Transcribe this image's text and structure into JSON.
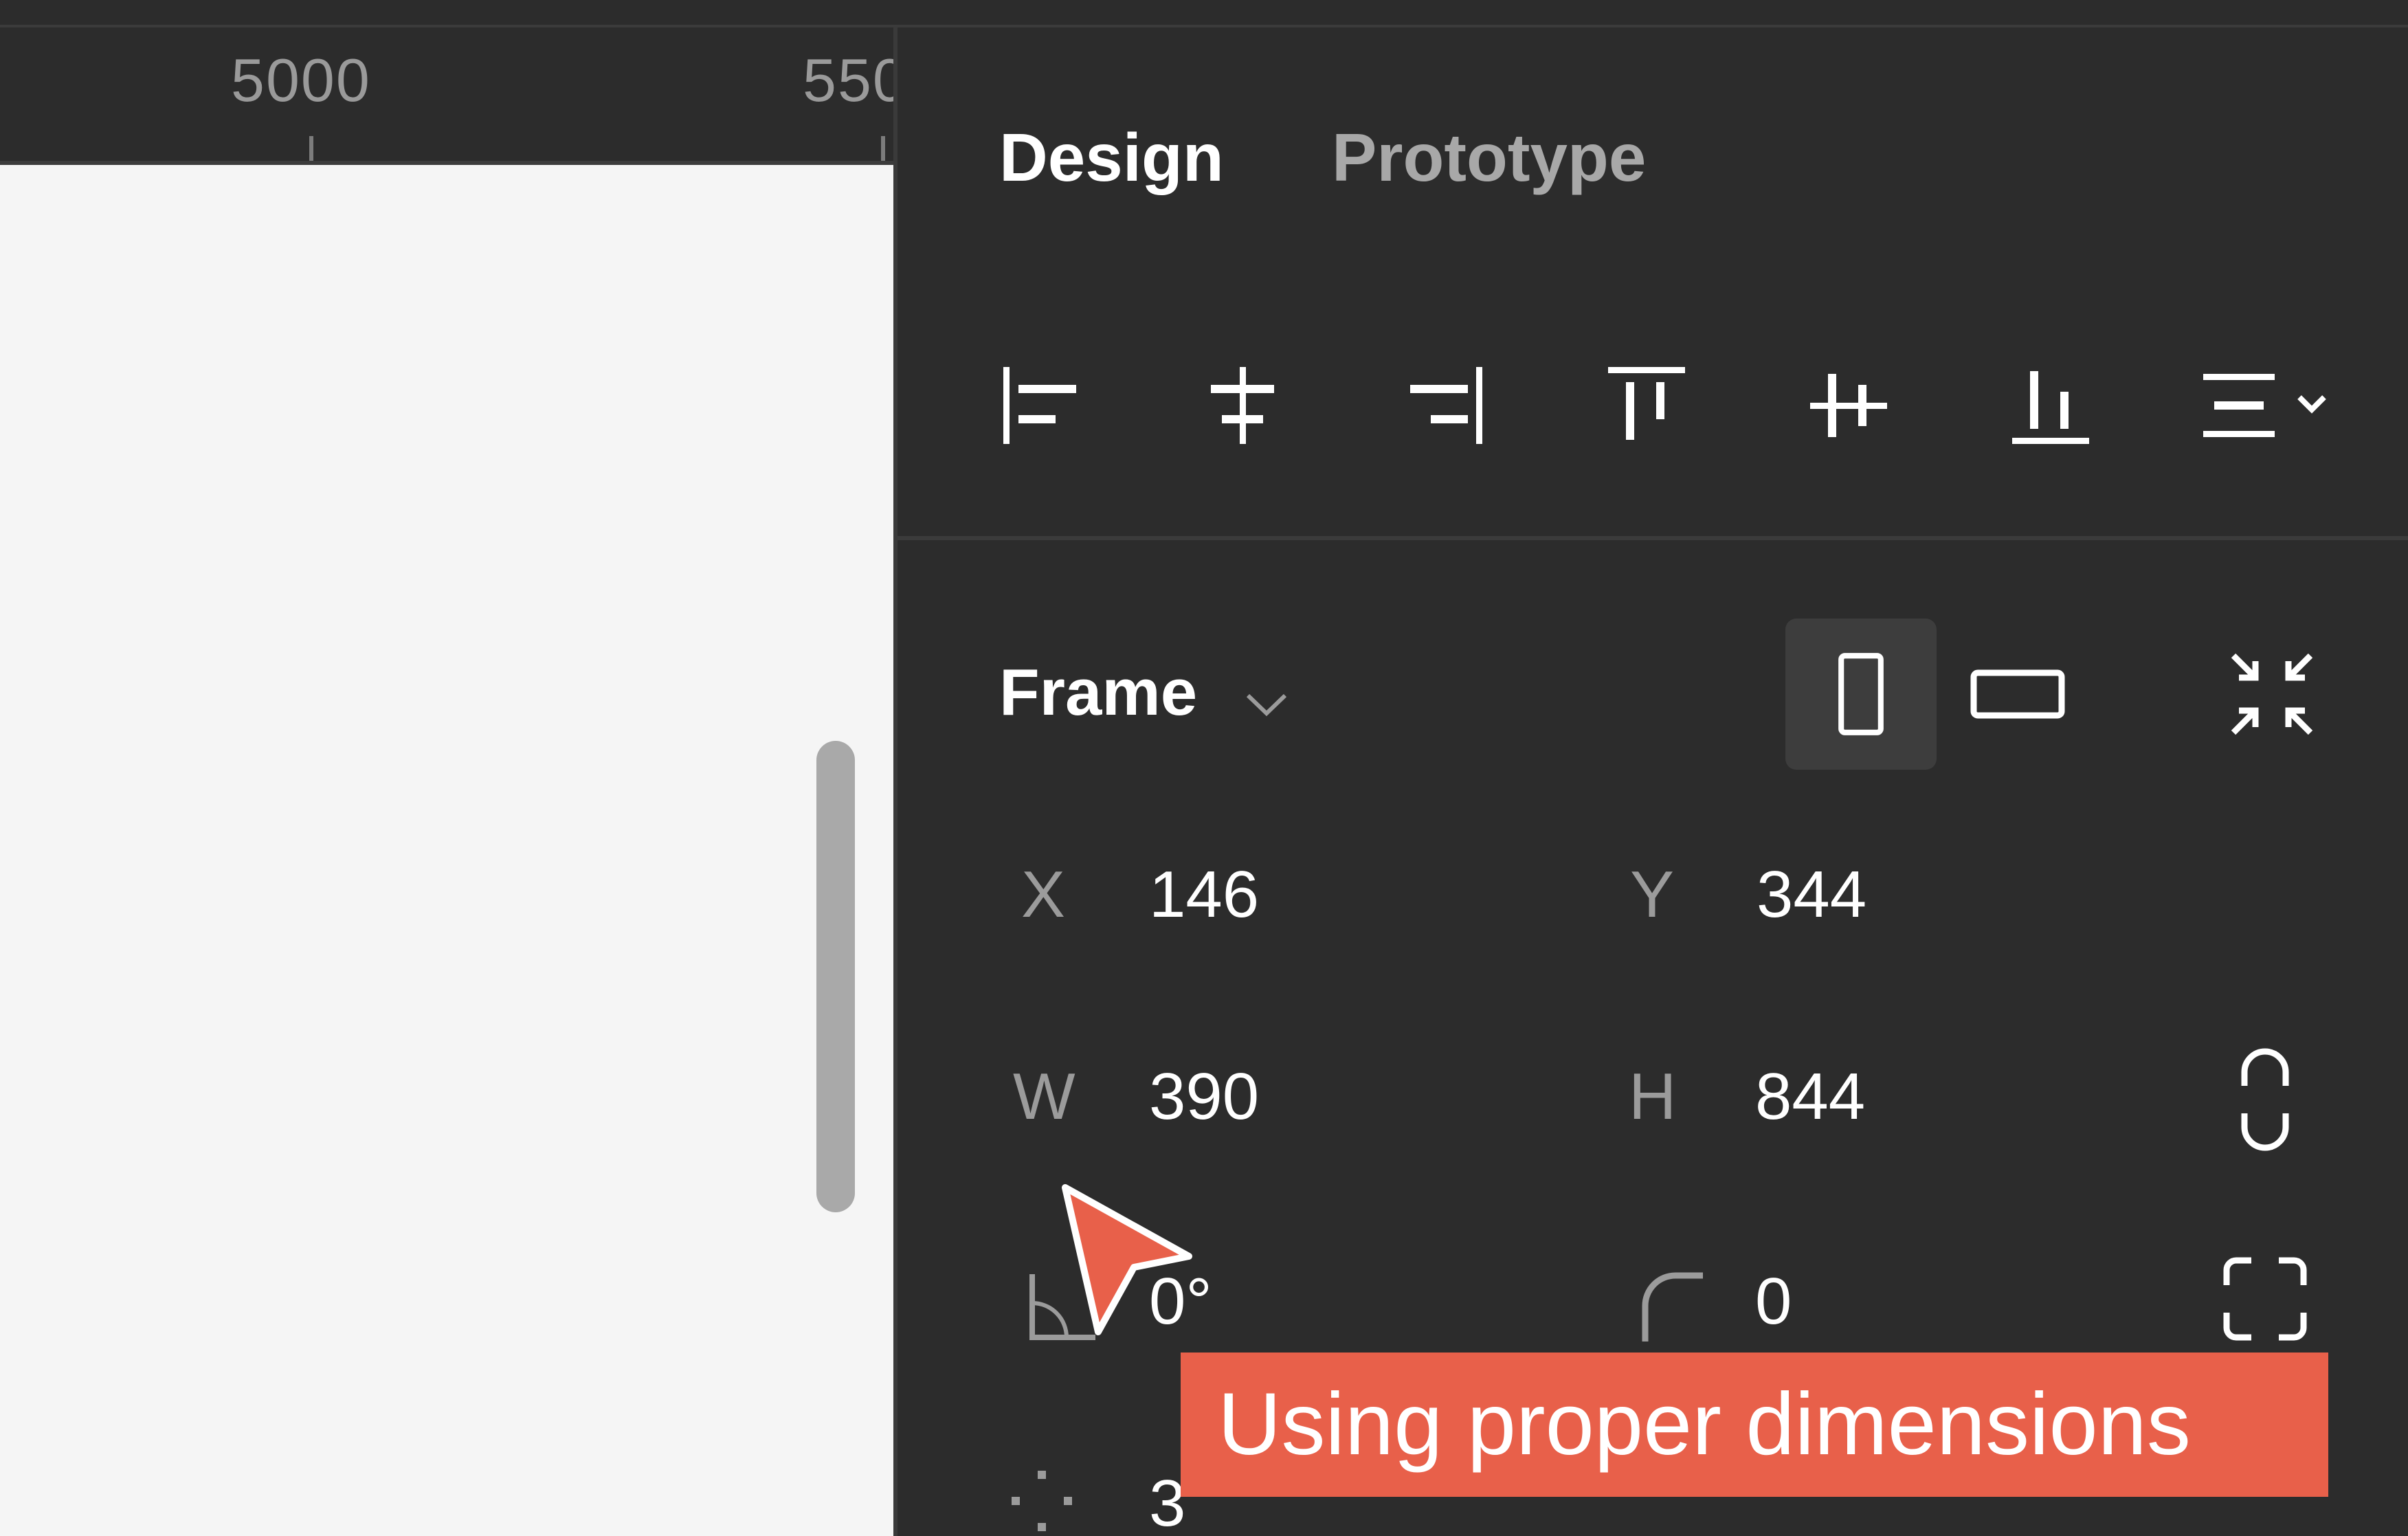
{
  "canvas": {
    "ruler_labels": [
      "5000",
      "550"
    ]
  },
  "panel": {
    "tabs": [
      {
        "label": "Design",
        "active": true
      },
      {
        "label": "Prototype",
        "active": false
      }
    ],
    "align_tools": [
      "align-left-icon",
      "align-horizontal-center-icon",
      "align-right-icon",
      "align-top-icon",
      "align-vertical-center-icon",
      "align-bottom-icon",
      "distribute-more-icon"
    ],
    "frame": {
      "title": "Frame",
      "orientation": "portrait",
      "x_label": "X",
      "x_value": "146",
      "y_label": "Y",
      "y_value": "344",
      "w_label": "W",
      "w_value": "390",
      "h_label": "H",
      "h_value": "844",
      "rotation_value": "0°",
      "corner_radius_value": "0",
      "partial_value": "3"
    }
  },
  "overlay": {
    "caption": "Using proper dimensions",
    "caption_color": "#e8604a"
  }
}
